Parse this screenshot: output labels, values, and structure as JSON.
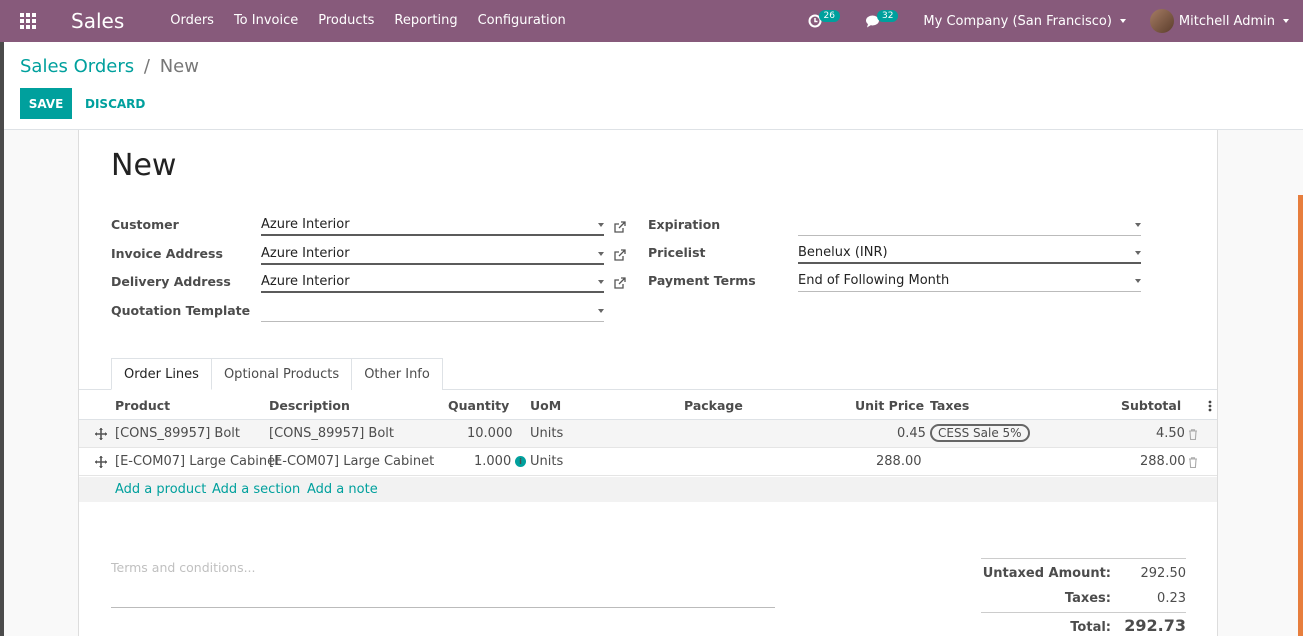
{
  "navbar": {
    "app_name": "Sales",
    "menu": [
      "Orders",
      "To Invoice",
      "Products",
      "Reporting",
      "Configuration"
    ],
    "activity_count": "26",
    "message_count": "32",
    "company": "My Company (San Francisco)",
    "user": "Mitchell Admin"
  },
  "breadcrumb": {
    "parent": "Sales Orders",
    "separator": "/",
    "current": "New"
  },
  "buttons": {
    "save": "SAVE",
    "discard": "DISCARD"
  },
  "form": {
    "title": "New",
    "left_fields": [
      {
        "label": "Customer",
        "value": "Azure Interior"
      },
      {
        "label": "Invoice Address",
        "value": "Azure Interior"
      },
      {
        "label": "Delivery Address",
        "value": "Azure Interior"
      },
      {
        "label": "Quotation Template",
        "value": ""
      }
    ],
    "right_fields": [
      {
        "label": "Expiration",
        "value": ""
      },
      {
        "label": "Pricelist",
        "value": "Benelux (INR)"
      },
      {
        "label": "Payment Terms",
        "value": "End of Following Month"
      }
    ]
  },
  "tabs": [
    "Order Lines",
    "Optional Products",
    "Other Info"
  ],
  "table": {
    "headers": [
      "Product",
      "Description",
      "Quantity",
      "UoM",
      "Package",
      "Unit Price",
      "Taxes",
      "Subtotal"
    ],
    "rows": [
      {
        "product": "[CONS_89957] Bolt",
        "description": "[CONS_89957] Bolt",
        "quantity": "10.000",
        "uom": "Units",
        "unit_price": "0.45",
        "taxes": "CESS Sale 5%",
        "subtotal": "4.50"
      },
      {
        "product": "[E-COM07] Large Cabinet",
        "description": "[E-COM07] Large Cabinet",
        "quantity": "1.000",
        "uom": "Units",
        "unit_price": "288.00",
        "taxes": "",
        "subtotal": "288.00"
      }
    ],
    "add_actions": [
      "Add a product",
      "Add a section",
      "Add a note"
    ]
  },
  "terms_placeholder": "Terms and conditions...",
  "totals": {
    "untaxed_label": "Untaxed Amount:",
    "untaxed_value": "292.50",
    "taxes_label": "Taxes:",
    "taxes_value": "0.23",
    "total_label": "Total:",
    "total_value": "292.73"
  },
  "colors": {
    "brand": "#875A7B",
    "accent": "#00A09D"
  }
}
